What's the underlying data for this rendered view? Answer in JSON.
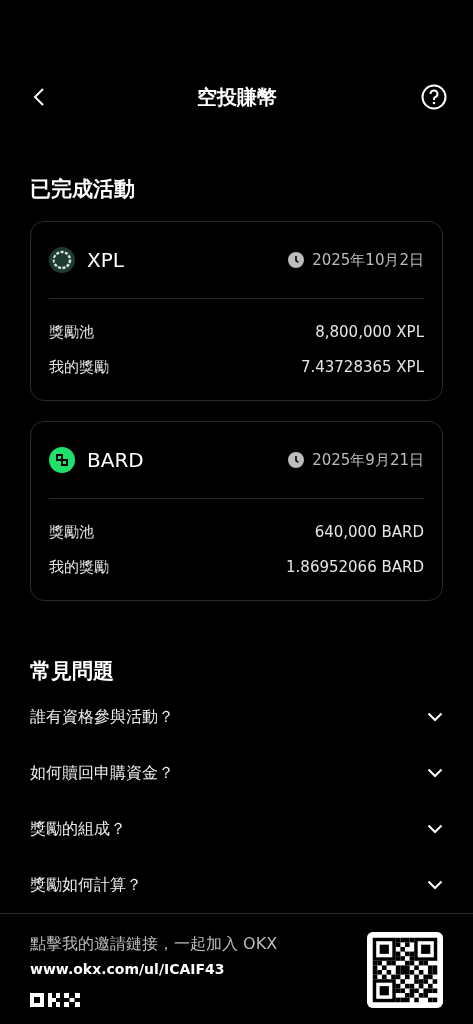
{
  "header": {
    "title": "空投賺幣"
  },
  "completed": {
    "title": "已完成活動",
    "activities": [
      {
        "token": "XPL",
        "kind": "xpl",
        "date": "2025年10月2日",
        "rows": [
          {
            "label": "獎勵池",
            "value": "8,800,000 XPL"
          },
          {
            "label": "我的獎勵",
            "value": "7.43728365 XPL"
          }
        ]
      },
      {
        "token": "BARD",
        "kind": "bard",
        "date": "2025年9月21日",
        "rows": [
          {
            "label": "獎勵池",
            "value": "640,000 BARD"
          },
          {
            "label": "我的獎勵",
            "value": "1.86952066 BARD"
          }
        ]
      }
    ]
  },
  "faq": {
    "title": "常見問題",
    "items": [
      {
        "question": "誰有資格參與活動？",
        "expanded": false
      },
      {
        "question": "如何贖回申購資金？",
        "expanded": false
      },
      {
        "question": "獎勵的組成？",
        "expanded": false
      },
      {
        "question": "獎勵如何計算？",
        "expanded": false
      }
    ]
  },
  "footer": {
    "text": "點擊我的邀請鏈接，一起加入 OKX",
    "link": "www.okx.com/ul/ICAIF43"
  }
}
